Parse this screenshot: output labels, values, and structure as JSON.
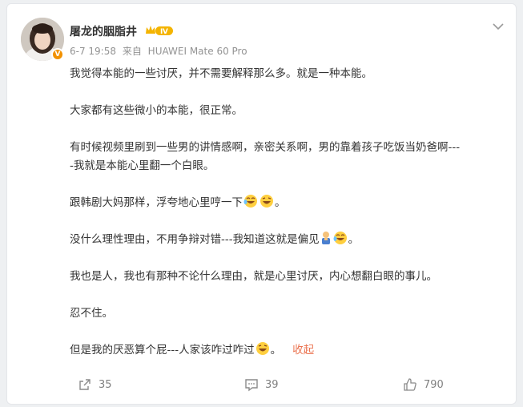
{
  "post": {
    "username": "屠龙的胭脂井",
    "level_badge": "Ⅳ",
    "verified_badge": "V",
    "time": "6-7 19:58",
    "source_prefix": "来自",
    "source_device": "HUAWEI Mate 60 Pro",
    "paragraphs": {
      "p1": "我觉得本能的一些讨厌，并不需要解释那么多。就是一种本能。",
      "p2": "大家都有这些微小的本能，很正常。",
      "p3": "有时候视频里刷到一些男的讲情感啊，亲密关系啊，男的靠着孩子吃饭当奶爸啊---",
      "p3b": "-我就是本能心里翻一个白眼。",
      "p4": "跟韩剧大妈那样，浮夸地心里哼一下",
      "p5": "没什么理性理由，不用争辩对错---我知道这就是偏见",
      "p6": "我也是人，我也有那种不论什么理由，就是心里讨厌，内心想翻白眼的事儿。",
      "p7": "忍不住。",
      "p8": "但是我的厌恶算个屁---人家该咋过咋过"
    },
    "period": "。",
    "collapse_label": "收起",
    "emojis": [
      "laugh-cry-emoji",
      "grin-laugh-emoji",
      "thumbs-person-emoji"
    ]
  },
  "actions": {
    "share_count": "35",
    "comment_count": "39",
    "like_count": "790"
  },
  "colors": {
    "accent": "#eb7350",
    "verified": "#f29100",
    "text": "#333333",
    "meta": "#939393"
  }
}
